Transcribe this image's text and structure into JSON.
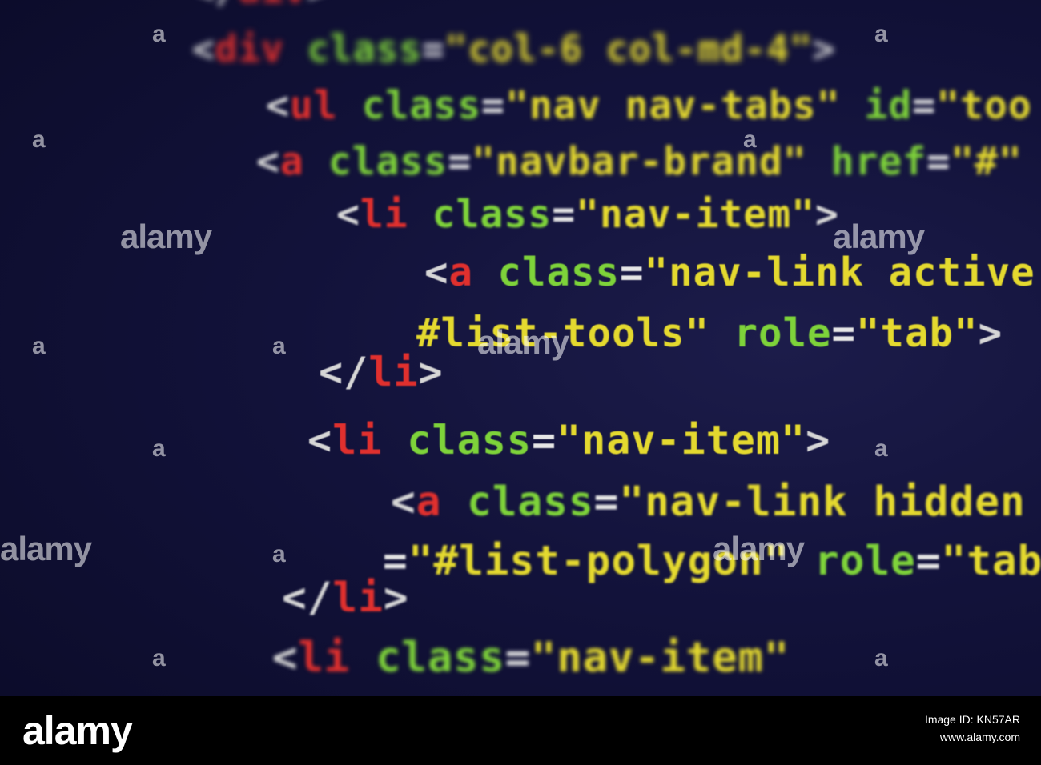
{
  "photo": {
    "code_lines": [
      {
        "tokens": [
          [
            "bracket",
            "</"
          ],
          [
            "tag",
            "div"
          ],
          [
            "bracket",
            ">"
          ]
        ]
      },
      {
        "tokens": [
          [
            "bracket",
            "<"
          ],
          [
            "tag",
            "div"
          ],
          [
            "attr",
            " class"
          ],
          [
            "eq",
            "="
          ],
          [
            "str",
            "\"col-6 col-md-4\""
          ],
          [
            "bracket",
            ">"
          ]
        ]
      },
      {
        "tokens": [
          [
            "bracket",
            "<"
          ],
          [
            "tag",
            "ul"
          ],
          [
            "attr",
            " class"
          ],
          [
            "eq",
            "="
          ],
          [
            "str",
            "\"nav nav-tabs\""
          ],
          [
            "attr",
            " id"
          ],
          [
            "eq",
            "="
          ],
          [
            "str",
            "\"too"
          ]
        ]
      },
      {
        "tokens": [
          [
            "bracket",
            "<"
          ],
          [
            "tag",
            "a"
          ],
          [
            "attr",
            " class"
          ],
          [
            "eq",
            "="
          ],
          [
            "str",
            "\"navbar-brand\""
          ],
          [
            "attr",
            " href"
          ],
          [
            "eq",
            "="
          ],
          [
            "str",
            "\"#\""
          ]
        ]
      },
      {
        "tokens": [
          [
            "bracket",
            "<"
          ],
          [
            "tag",
            "li"
          ],
          [
            "attr",
            " class"
          ],
          [
            "eq",
            "="
          ],
          [
            "str",
            "\"nav-item\""
          ],
          [
            "bracket",
            ">"
          ]
        ]
      },
      {
        "tokens": [
          [
            "bracket",
            "<"
          ],
          [
            "tag",
            "a"
          ],
          [
            "attr",
            " class"
          ],
          [
            "eq",
            "="
          ],
          [
            "str",
            "\"nav-link active"
          ]
        ]
      },
      {
        "tokens": [
          [
            "str",
            "#list-tools\""
          ],
          [
            "attr",
            " role"
          ],
          [
            "eq",
            "="
          ],
          [
            "str",
            "\"tab\""
          ],
          [
            "bracket",
            ">"
          ]
        ]
      },
      {
        "tokens": [
          [
            "bracket",
            "</"
          ],
          [
            "tag",
            "li"
          ],
          [
            "bracket",
            ">"
          ]
        ]
      },
      {
        "tokens": [
          [
            "bracket",
            "<"
          ],
          [
            "tag",
            "li"
          ],
          [
            "attr",
            " class"
          ],
          [
            "eq",
            "="
          ],
          [
            "str",
            "\"nav-item\""
          ],
          [
            "bracket",
            ">"
          ]
        ]
      },
      {
        "tokens": [
          [
            "bracket",
            "<"
          ],
          [
            "tag",
            "a"
          ],
          [
            "attr",
            " class"
          ],
          [
            "eq",
            "="
          ],
          [
            "str",
            "\"nav-link hidden"
          ]
        ]
      },
      {
        "tokens": [
          [
            "eq",
            "="
          ],
          [
            "str",
            "\"#list-polygon\""
          ],
          [
            "attr",
            " role"
          ],
          [
            "eq",
            "="
          ],
          [
            "str",
            "\"tab"
          ]
        ]
      },
      {
        "tokens": [
          [
            "bracket",
            "</"
          ],
          [
            "tag",
            "li"
          ],
          [
            "bracket",
            ">"
          ]
        ]
      },
      {
        "tokens": [
          [
            "bracket",
            "<"
          ],
          [
            "tag",
            "li"
          ],
          [
            "attr",
            " class"
          ],
          [
            "eq",
            "="
          ],
          [
            "str",
            "\"nav-item\""
          ]
        ]
      }
    ],
    "watermark_text": "alamy",
    "watermark_dot": "a"
  },
  "footer": {
    "logo": "alamy",
    "image_id_label": "Image ID: KN57AR",
    "site": "www.alamy.com"
  }
}
